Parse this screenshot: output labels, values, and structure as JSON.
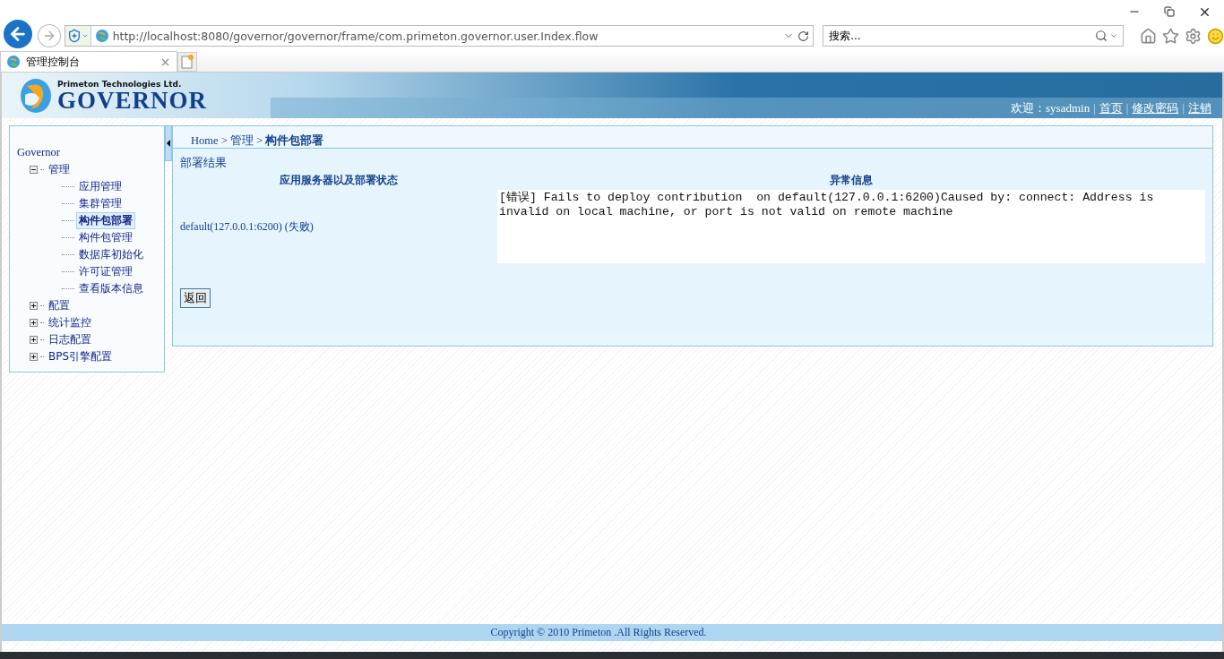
{
  "browser": {
    "address": "http://localhost:8080/governor/governor/frame/com.primeton.governor.user.Index.flow",
    "search": {
      "placeholder": "搜索..."
    },
    "tabs": [
      {
        "label": "管理控制台",
        "selected": true
      }
    ]
  },
  "header": {
    "company": "Primeton Technologies Ltd.",
    "product": "GOVERNOR",
    "welcome": "欢迎：sysadmin",
    "separator": "|",
    "links": [
      "首页",
      "修改密码",
      "注销"
    ]
  },
  "sidebar": {
    "root": "Governor",
    "items": [
      {
        "label": "管理",
        "expanded": true,
        "selected": false,
        "children": [
          {
            "label": "应用管理",
            "selected": false
          },
          {
            "label": "集群管理",
            "selected": false
          },
          {
            "label": "构件包部署",
            "selected": true
          },
          {
            "label": "构件包管理",
            "selected": false
          },
          {
            "label": "数据库初始化",
            "selected": false
          },
          {
            "label": "许可证管理",
            "selected": false
          },
          {
            "label": "查看版本信息",
            "selected": false
          }
        ]
      },
      {
        "label": "配置",
        "expanded": false,
        "selected": false
      },
      {
        "label": "统计监控",
        "expanded": false,
        "selected": false
      },
      {
        "label": "日志配置",
        "expanded": false,
        "selected": false
      },
      {
        "label": "BPS引擎配置",
        "expanded": false,
        "selected": false
      }
    ]
  },
  "breadcrumb": "Home > 管理 > **构件包部署**",
  "content": {
    "section_title": "部署结果",
    "columns": [
      "应用服务器以及部署状态",
      "异常信息"
    ],
    "rows": [
      {
        "server": "default(127.0.0.1:6200) (失败)",
        "error": "[错误] Fails to deploy contribution  on default(127.0.0.1:6200)Caused by: connect: Address is invalid on local machine, or port is not valid on remote machine"
      }
    ],
    "button": "返回"
  },
  "footer": "Copyright © 2010 Primeton .All Rights Reserved."
}
